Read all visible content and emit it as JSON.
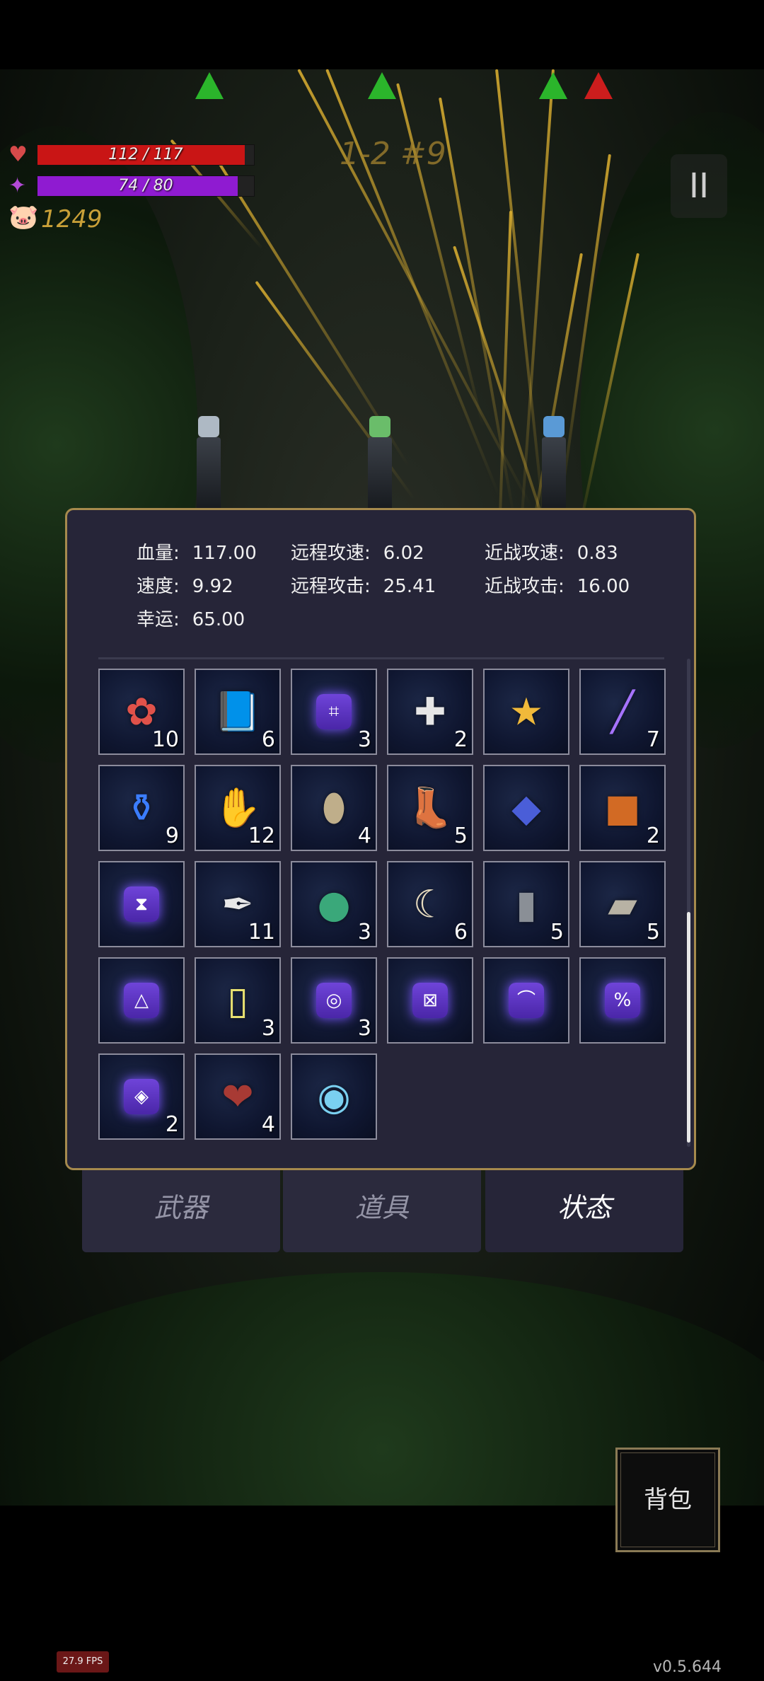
{
  "hud": {
    "hp_text": "112 / 117",
    "hp_fraction": 0.957,
    "mp_text": "74 / 80",
    "mp_fraction": 0.925,
    "coins": "1249",
    "wave": "1-2 #9",
    "pause_symbol": "II"
  },
  "stats": [
    {
      "label": "血量:",
      "value": "117.00"
    },
    {
      "label": "远程攻速:",
      "value": "6.02"
    },
    {
      "label": "近战攻速:",
      "value": "0.83"
    },
    {
      "label": "速度:",
      "value": "9.92"
    },
    {
      "label": "远程攻击:",
      "value": "25.41"
    },
    {
      "label": "近战攻击:",
      "value": "16.00"
    },
    {
      "label": "幸运:",
      "value": "65.00"
    }
  ],
  "items": [
    {
      "icon": "red-flowers-icon",
      "count": "10"
    },
    {
      "icon": "blue-spellbook-icon",
      "count": "6"
    },
    {
      "icon": "purple-rune-icon",
      "count": "3"
    },
    {
      "icon": "holy-shield-ring-icon",
      "count": "2"
    },
    {
      "icon": "star-trophy-icon",
      "count": ""
    },
    {
      "icon": "purple-wand-icon",
      "count": "7"
    },
    {
      "icon": "blue-potion-icon",
      "count": "9"
    },
    {
      "icon": "red-gloves-icon",
      "count": "12"
    },
    {
      "icon": "egg-icon",
      "count": "4"
    },
    {
      "icon": "purple-boots-icon",
      "count": "5"
    },
    {
      "icon": "blue-tome-icon",
      "count": ""
    },
    {
      "icon": "orange-tome-icon",
      "count": "2"
    },
    {
      "icon": "hourglass-rune-icon",
      "count": ""
    },
    {
      "icon": "feather-icon",
      "count": "11"
    },
    {
      "icon": "rainbow-orb-icon",
      "count": "3"
    },
    {
      "icon": "horn-icon",
      "count": "6"
    },
    {
      "icon": "tombstone-icon",
      "count": "5"
    },
    {
      "icon": "ore-rocks-icon",
      "count": "5"
    },
    {
      "icon": "triangle-rune-icon",
      "count": ""
    },
    {
      "icon": "yellow-card-icon",
      "count": "3"
    },
    {
      "icon": "spiral-rune-icon",
      "count": "3"
    },
    {
      "icon": "cross-rune-icon",
      "count": ""
    },
    {
      "icon": "hook-rune-icon",
      "count": ""
    },
    {
      "icon": "percent-rune-icon",
      "count": ""
    },
    {
      "icon": "eye-rune-icon",
      "count": "2"
    },
    {
      "icon": "burning-heart-icon",
      "count": "4"
    },
    {
      "icon": "crystal-orb-icon",
      "count": ""
    }
  ],
  "tabs": [
    {
      "label": "武器",
      "active": false
    },
    {
      "label": "道具",
      "active": false
    },
    {
      "label": "状态",
      "active": true
    }
  ],
  "bag_label": "背包",
  "fps": "27.9 FPS",
  "version": "v0.5.644",
  "colors": {
    "hp": "#c91515",
    "mp": "#8f1bd1",
    "panel_border": "#a68a4d",
    "gold": "#c9a038"
  }
}
